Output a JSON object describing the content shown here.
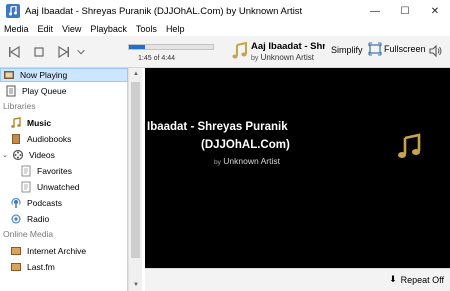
{
  "window": {
    "title": "Aaj Ibaadat - Shreyas Puranik (DJJOhAL.Com) by Unknown Artist",
    "minimize_glyph": "—",
    "maximize_glyph": "☐",
    "close_glyph": "✕"
  },
  "menu": [
    "Media",
    "Edit",
    "View",
    "Playback",
    "Tools",
    "Help"
  ],
  "toolbar": {
    "progress": 0.19,
    "time": "1:45 of 4:44",
    "track_title": "Aaj Ibaadat - Shre...",
    "artist_by": "by",
    "artist": "Unknown Artist",
    "simplify_label": "Simplify",
    "fullscreen_label": "Fullscreen"
  },
  "sidebar": {
    "now_playing": "Now Playing",
    "play_queue": "Play Queue",
    "libraries_header": "Libraries",
    "music": "Music",
    "audiobooks": "Audiobooks",
    "videos": "Videos",
    "favorites": "Favorites",
    "unwatched": "Unwatched",
    "podcasts": "Podcasts",
    "radio": "Radio",
    "online_header": "Online Media",
    "internet_archive": "Internet Archive",
    "last_fm": "Last.fm"
  },
  "video": {
    "title_line": "Ibaadat - Shreyas Puranik",
    "sub_line": "(DJJOhAL.Com)",
    "artist_by": "by",
    "artist": "Unknown Artist"
  },
  "status": {
    "repeat_label": "Repeat Off"
  },
  "colors": {
    "accent": "#1d6fd6",
    "note_gold": "#c9a34a"
  }
}
